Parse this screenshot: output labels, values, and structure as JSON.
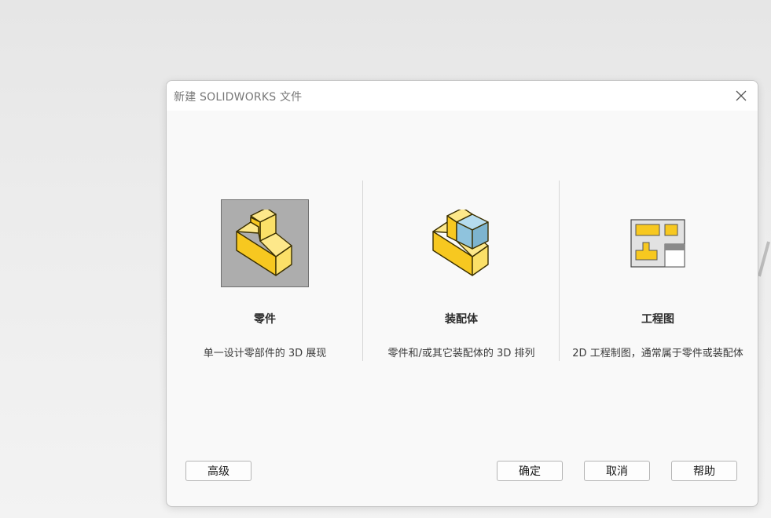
{
  "dialog": {
    "title": "新建 SOLIDWORKS 文件",
    "close_icon": "close-icon"
  },
  "options": [
    {
      "label": "零件",
      "description": "单一设计零部件的 3D 展现",
      "icon": "part-icon",
      "selected": true
    },
    {
      "label": "装配体",
      "description": "零件和/或其它装配体的 3D 排列",
      "icon": "assembly-icon",
      "selected": false
    },
    {
      "label": "工程图",
      "description": "2D 工程制图，通常属于零件或装配体",
      "icon": "drawing-icon",
      "selected": false
    }
  ],
  "buttons": {
    "advanced": "高级",
    "ok": "确定",
    "cancel": "取消",
    "help": "帮助"
  },
  "colors": {
    "part_yellow": "#f7c820",
    "assembly_blue": "#8fc3dd",
    "selected_bg": "#adadad"
  }
}
